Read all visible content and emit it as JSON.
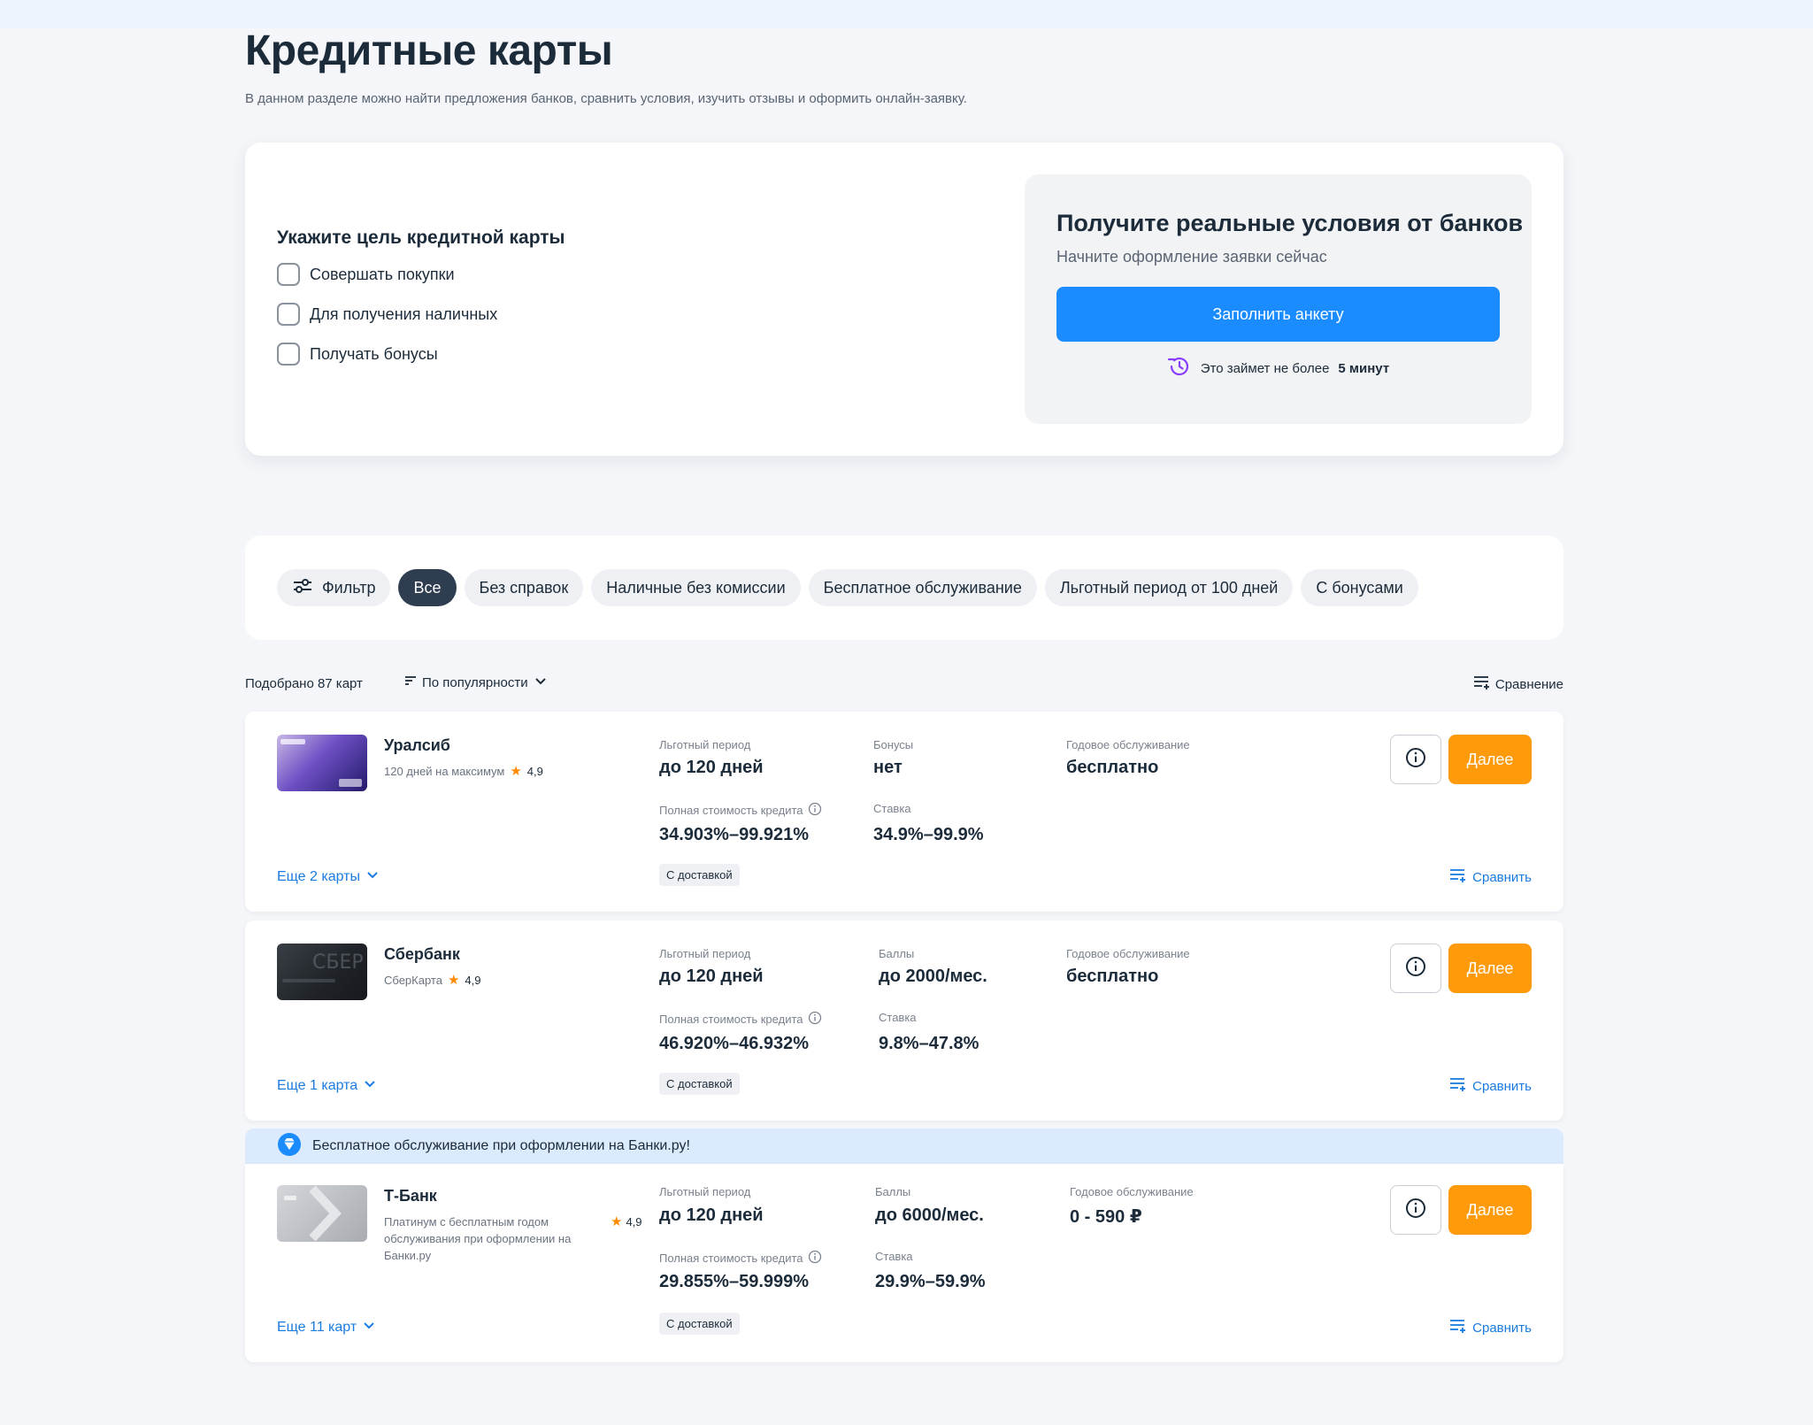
{
  "page": {
    "title": "Кредитные карты",
    "subtitle": "В данном разделе можно найти предложения банков, сравнить условия, изучить отзывы и оформить онлайн-заявку."
  },
  "purpose": {
    "title": "Укажите цель кредитной карты",
    "options": [
      "Совершать покупки",
      "Для получения наличных",
      "Получать бонусы"
    ]
  },
  "promo": {
    "title": "Получите реальные условия от банков",
    "subtitle": "Начните оформление заявки сейчас",
    "button": "Заполнить анкету",
    "note_prefix": "Это займет не более",
    "note_bold": "5 минут",
    "icon": "clock-rewind-icon"
  },
  "filters": {
    "filter_label": "Фильтр",
    "chips": [
      "Все",
      "Без справок",
      "Наличные без комиссии",
      "Бесплатное обслуживание",
      "Льготный период от 100 дней",
      "С бонусами"
    ],
    "active": "Все"
  },
  "results": {
    "count": "Подобрано 87 карт",
    "sort": "По популярности",
    "compare": "Сравнение"
  },
  "offers": [
    {
      "bank": "Уралсиб",
      "subtitle": "120 дней на максимум",
      "rating": "4,9",
      "grace_label": "Льготный период",
      "grace_value": "до 120 дней",
      "bonus_label": "Бонусы",
      "bonus_value": "нет",
      "service_label": "Годовое обслуживание",
      "service_value": "бесплатно",
      "cost_label": "Полная стоимость кредита",
      "cost_value": "34.903%–99.921%",
      "rate_label": "Ставка",
      "rate_value": "34.9%–99.9%",
      "tag": "С доставкой",
      "more": "Еще 2 карты",
      "compare": "Сравнить",
      "next": "Далее"
    },
    {
      "bank": "Сбербанк",
      "subtitle": "СберКарта",
      "rating": "4,9",
      "grace_label": "Льготный период",
      "grace_value": "до 120 дней",
      "bonus_label": "Баллы",
      "bonus_value": "до 2000/мес.",
      "service_label": "Годовое обслуживание",
      "service_value": "бесплатно",
      "cost_label": "Полная стоимость кредита",
      "cost_value": "46.920%–46.932%",
      "rate_label": "Ставка",
      "rate_value": "9.8%–47.8%",
      "tag": "С доставкой",
      "more": "Еще 1 карта",
      "compare": "Сравнить",
      "next": "Далее"
    },
    {
      "banner": "Бесплатное обслуживание при оформлении на Банки.ру!",
      "bank": "Т-Банк",
      "subtitle": "Платинум с бесплатным годом обслуживания при оформлении на Банки.ру",
      "rating": "4,9",
      "grace_label": "Льготный период",
      "grace_value": "до 120 дней",
      "bonus_label": "Баллы",
      "bonus_value": "до 6000/мес.",
      "service_label": "Годовое обслуживание",
      "service_value": "0 - 590 ₽",
      "cost_label": "Полная стоимость кредита",
      "cost_value": "29.855%–59.999%",
      "rate_label": "Ставка",
      "rate_value": "29.9%–59.9%",
      "tag": "С доставкой",
      "more": "Еще 11 карт",
      "compare": "Сравнить",
      "next": "Далее"
    }
  ],
  "colors": {
    "primary": "#1a8cff",
    "accent": "#ff9b0a",
    "link": "#1a7be0",
    "chip_active": "#2f3d50",
    "banner": "#dbeafc"
  }
}
